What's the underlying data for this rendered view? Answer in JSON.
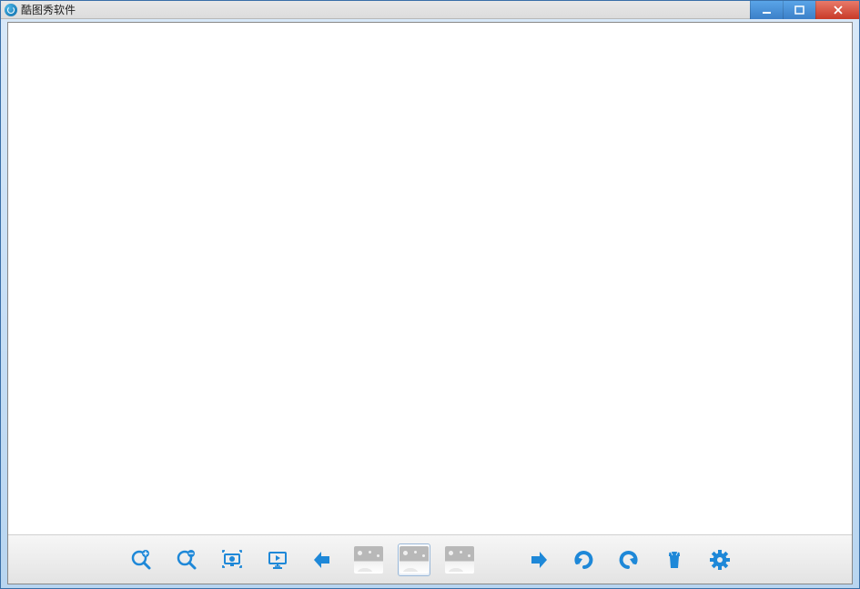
{
  "window": {
    "title": "酷图秀软件"
  },
  "toolbar": {
    "zoom_in_label": "zoom-in",
    "zoom_out_label": "zoom-out",
    "fit_label": "fit-screen",
    "slideshow_label": "slideshow",
    "prev_label": "previous",
    "image_a_label": "image-a",
    "image_b_label": "image-b",
    "image_c_label": "image-c",
    "next_label": "next",
    "undo_label": "undo",
    "redo_label": "redo",
    "delete_label": "delete",
    "settings_label": "settings"
  },
  "colors": {
    "accent": "#1e88d8"
  }
}
